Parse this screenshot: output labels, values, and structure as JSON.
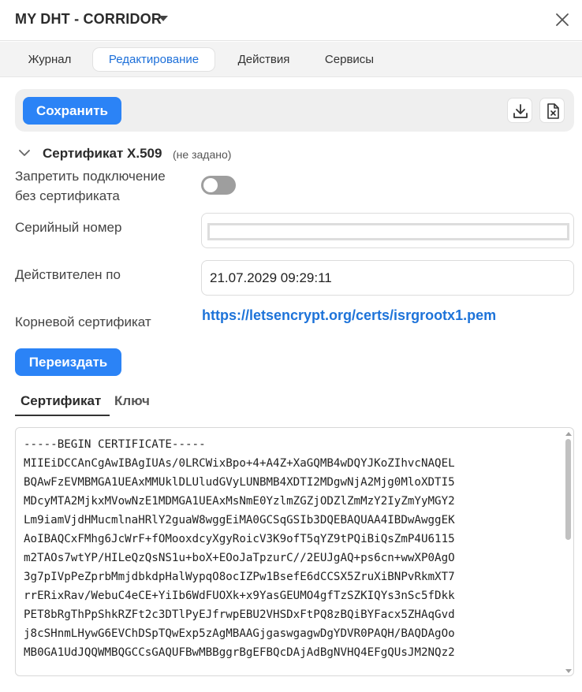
{
  "header": {
    "title": "MY DHT - CORRIDOR",
    "dropdown_icon": "caret-down-icon",
    "close_icon": "close-icon"
  },
  "tabs": [
    {
      "label": "Журнал",
      "active": false
    },
    {
      "label": "Редактирование",
      "active": true
    },
    {
      "label": "Действия",
      "active": false
    },
    {
      "label": "Сервисы",
      "active": false
    }
  ],
  "toolbar": {
    "save_label": "Сохранить",
    "download_icon": "download-icon",
    "delete_file_icon": "file-delete-icon"
  },
  "section": {
    "title": "Сертификат X.509",
    "status": "(не задано)"
  },
  "fields": {
    "deny_label_line1": "Запретить подключение",
    "deny_label_line2": "без сертификата",
    "deny_value": false,
    "serial_label": "Серийный номер",
    "serial_value": "",
    "valid_label": "Действителен по",
    "valid_value": "21.07.2029 09:29:11",
    "root_label": "Корневой сертификат",
    "root_link": "https://letsencrypt.org/certs/isrgrootx1.pem"
  },
  "reissue_label": "Переиздать",
  "subtabs": [
    {
      "label": "Сертификат",
      "active": true
    },
    {
      "label": "Ключ",
      "active": false
    }
  ],
  "certificate_lines": [
    "-----BEGIN CERTIFICATE-----",
    "MIIEiDCCAnCgAwIBAgIUAs/0LRCWixBpo+4+A4Z+XaGQMB4wDQYJKoZIhvcNAQEL",
    "BQAwFzEVMBMGA1UEAxMMUklDLUludGVyLUNBMB4XDTI2MDgwNjA2Mjg0MloXDTI5",
    "MDcyMTA2MjkxMVowNzE1MDMGA1UEAxMsNmE0YzlmZGZjODZlZmMzY2IyZmYyMGY2",
    "Lm9iamVjdHMucmlnaHRlY2guaW8wggEiMA0GCSqGSIb3DQEBAQUAA4IBDwAwggEK",
    "AoIBAQCxFMhg6JcWrF+fOMooxdcyXgyRoicV3K9ofT5qYZ9tPQiBiQsZmP4U6115",
    "m2TAOs7wtYP/HILeQzQsNS1u+boX+EOoJaTpzurC//2EUJgAQ+ps6cn+wwXP0AgO",
    "3g7pIVpPeZprbMmjdbkdpHalWypqO8ocIZPw1BsefE6dCCSX5ZruXiBNPvRkmXT7",
    "rrERixRav/WebuC4eCE+YiIb6WdFUOXk+x9YasGEUMO4gfTzSZKIQYs3nSc5fDkk",
    "PET8bRgThPpShkRZFt2c3DTlPyEJfrwpEBU2VHSDxFtPQ8zBQiBYFacx5ZHAqGvd",
    "j8cSHnmLHywG6EVChDSpTQwExp5zAgMBAAGjgaswgagwDgYDVR0PAQH/BAQDAgOo",
    "MB0GA1UdJQQWMBQGCCsGAQUFBwMBBggrBgEFBQcDAjAdBgNVHQ4EFgQUsJM2NQz2"
  ],
  "colors": {
    "accent": "#2b83f6",
    "link": "#1d73d9",
    "toggle_off": "#9e9e9e"
  }
}
